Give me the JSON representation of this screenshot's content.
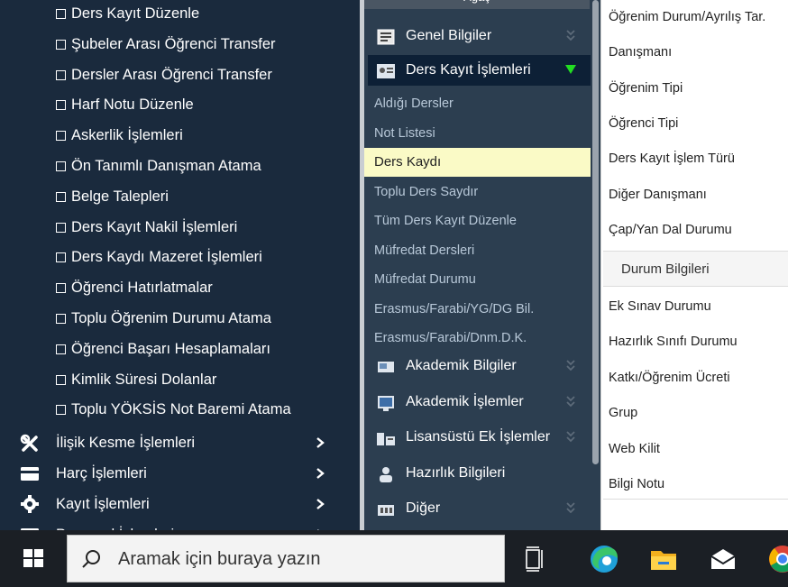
{
  "left_menu": {
    "sub_items": [
      "Ders Kayıt Düzenle",
      "Şubeler Arası Öğrenci Transfer",
      "Dersler Arası Öğrenci Transfer",
      "Harf Notu Düzenle",
      "Askerlik İşlemleri",
      "Ön Tanımlı Danışman Atama",
      "Belge Talepleri",
      "Ders Kayıt Nakil İşlemleri",
      "Ders Kaydı Mazeret İşlemleri",
      "Öğrenci Hatırlatmalar",
      "Toplu Öğrenim Durumu Atama",
      "Öğrenci Başarı Hesaplamaları",
      "Kimlik Süresi Dolanlar",
      "Toplu YÖKSİS Not Baremi Atama"
    ],
    "main_items": [
      {
        "label": "İlişik Kesme İşlemleri",
        "icon": "unlink-icon"
      },
      {
        "label": "Harç İşlemleri",
        "icon": "credit-card-icon"
      },
      {
        "label": "Kayıt İşlemleri",
        "icon": "gear-icon"
      },
      {
        "label": "Personel İşlemleri",
        "icon": "id-card-icon"
      }
    ]
  },
  "middle_menu": {
    "header": "Ağaç",
    "groups_top": [
      {
        "label": "Genel Bilgiler",
        "icon": "document-icon",
        "active": false
      },
      {
        "label": "Ders Kayıt İşlemleri",
        "icon": "registration-icon",
        "active": true
      }
    ],
    "links": [
      {
        "label": "Aldığı Dersler",
        "selected": false
      },
      {
        "label": "Not Listesi",
        "selected": false
      },
      {
        "label": "Ders Kaydı",
        "selected": true
      },
      {
        "label": "Toplu Ders Saydır",
        "selected": false
      },
      {
        "label": "Tüm Ders Kayıt Düzenle",
        "selected": false
      },
      {
        "label": "Müfredat Dersleri",
        "selected": false
      },
      {
        "label": "Müfredat Durumu",
        "selected": false
      },
      {
        "label": "Erasmus/Farabi/YG/DG Bil.",
        "selected": false
      },
      {
        "label": "Erasmus/Farabi/Dnm.D.K.",
        "selected": false
      }
    ],
    "groups_bottom": [
      {
        "label": "Akademik Bilgiler",
        "icon": "academic-info-icon",
        "chevron": true
      },
      {
        "label": "Akademik İşlemler",
        "icon": "academic-operations-icon",
        "chevron": true
      },
      {
        "label": "Lisansüstü Ek İşlemler",
        "icon": "graduate-icon",
        "chevron": true
      },
      {
        "label": "Hazırlık Bilgileri",
        "icon": "person-icon",
        "chevron": false
      },
      {
        "label": "Diğer",
        "icon": "other-icon",
        "chevron": true
      }
    ]
  },
  "right_panel": {
    "fields_top": [
      "Öğrenim Durum/Ayrılış Tar.",
      "Danışmanı",
      "Öğrenim Tipi",
      "Öğrenci Tipi",
      "Ders Kayıt İşlem Türü",
      "Diğer Danışmanı",
      "Çap/Yan Dal Durumu"
    ],
    "section_title": "Durum Bilgileri",
    "fields_bottom": [
      "Ek Sınav Durumu",
      "Hazırlık Sınıfı Durumu",
      "Katkı/Öğrenim Ücreti",
      "Grup",
      "Web Kilit",
      "Bilgi Notu"
    ]
  },
  "taskbar": {
    "search_placeholder": "Aramak için buraya yazın",
    "apps": [
      "task-view-icon",
      "edge-icon",
      "file-explorer-icon",
      "mail-icon",
      "chrome-icon"
    ]
  },
  "colors": {
    "sidebar_bg": "#1a2a3d",
    "menu_bg": "#2c3e50",
    "active_group_bg": "#0d2036",
    "selected_link_bg": "#fafac6",
    "link_text": "#b8c8d8",
    "active_arrow": "#22dd22",
    "taskbar_bg": "#1b1f25"
  }
}
